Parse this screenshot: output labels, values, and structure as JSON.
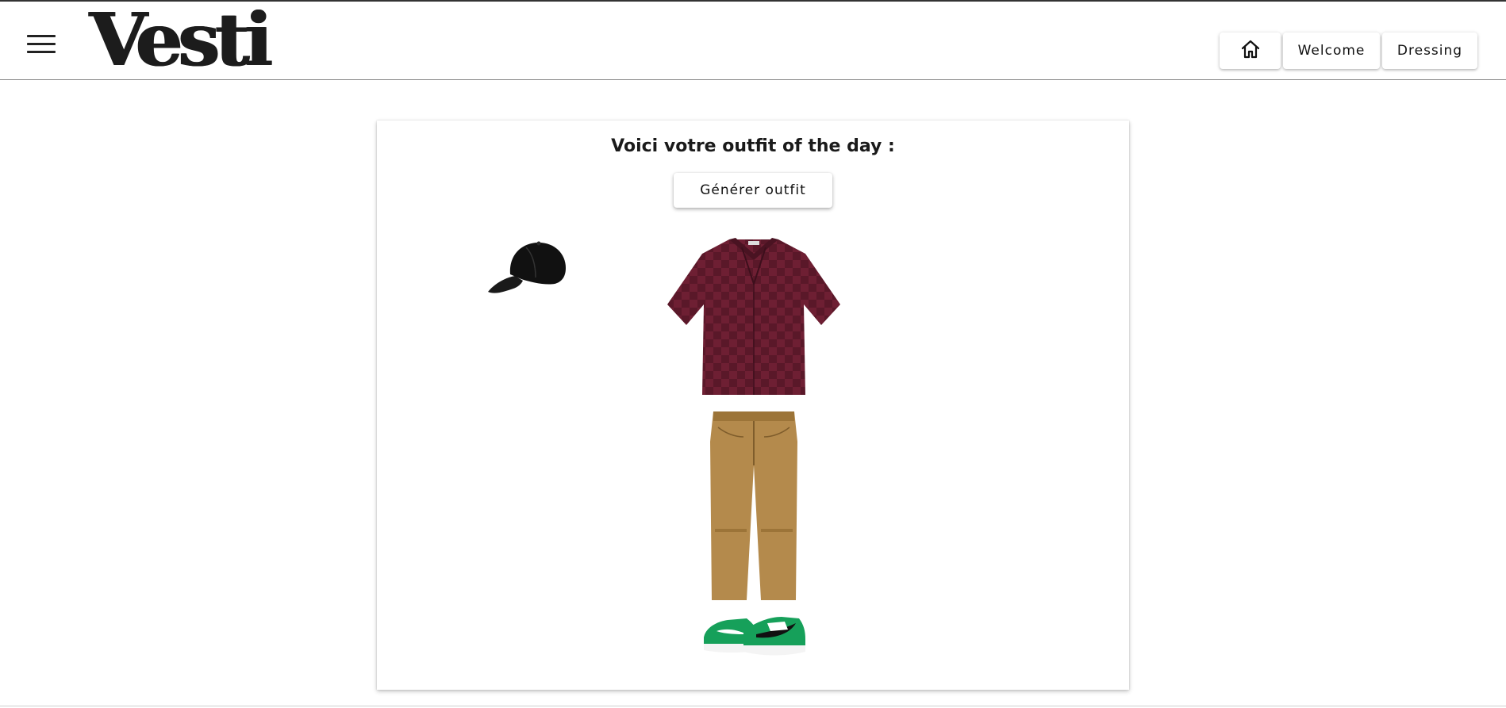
{
  "app": {
    "logo_text": "Vesti"
  },
  "nav": {
    "home_icon": "home-icon",
    "welcome_label": "Welcome",
    "dressing_label": "Dressing"
  },
  "outfit": {
    "title": "Voici votre outfit of the day :",
    "generate_label": "Générer outfit",
    "items": [
      {
        "type": "cap",
        "color": "#111111"
      },
      {
        "type": "shirt",
        "color": "#6e1f33"
      },
      {
        "type": "pants",
        "color": "#b48a4c"
      },
      {
        "type": "sneakers",
        "color": "#16a05a"
      }
    ]
  }
}
